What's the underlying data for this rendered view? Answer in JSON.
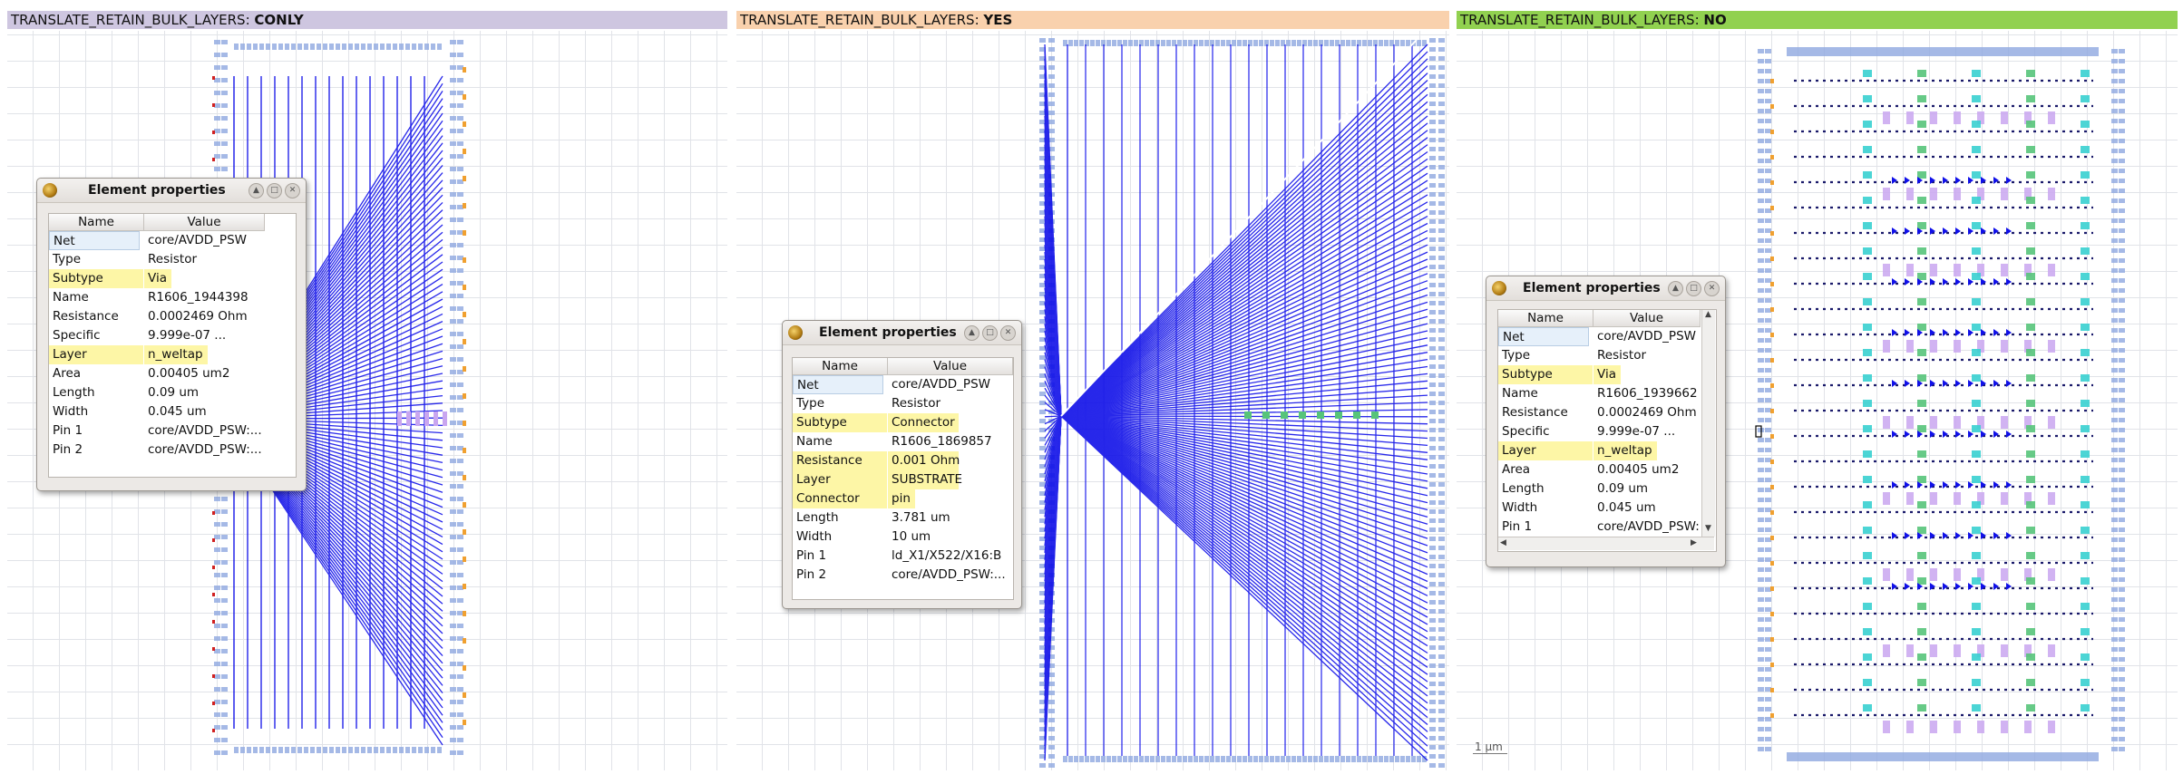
{
  "panels": [
    {
      "header_prefix": "TRANSLATE_RETAIN_BULK_LAYERS: ",
      "header_value": "CONLY",
      "color": "#cec6e0"
    },
    {
      "header_prefix": "TRANSLATE_RETAIN_BULK_LAYERS: ",
      "header_value": "YES",
      "color": "#f9d1ad"
    },
    {
      "header_prefix": "TRANSLATE_RETAIN_BULK_LAYERS: ",
      "header_value": "NO",
      "color": "#91d150"
    }
  ],
  "dialogs": [
    {
      "title": "Element properties",
      "col_name": "Name",
      "col_value": "Value",
      "rows": [
        {
          "name": "Net",
          "value": "core/AVDD_PSW"
        },
        {
          "name": "Type",
          "value": "Resistor"
        },
        {
          "name": "Subtype",
          "value": "Via"
        },
        {
          "name": "Name",
          "value": "R1606_1944398"
        },
        {
          "name": "Resistance",
          "value": "0.0002469 Ohm"
        },
        {
          "name": "Specific",
          "value": "9.999e-07 ..."
        },
        {
          "name": "Layer",
          "value": "n_weltap"
        },
        {
          "name": "Area",
          "value": "0.00405 um2"
        },
        {
          "name": "Length",
          "value": "0.09 um"
        },
        {
          "name": "Width",
          "value": "0.045 um"
        },
        {
          "name": "Pin 1",
          "value": "core/AVDD_PSW:..."
        },
        {
          "name": "Pin 2",
          "value": "core/AVDD_PSW:..."
        }
      ]
    },
    {
      "title": "Element properties",
      "col_name": "Name",
      "col_value": "Value",
      "rows": [
        {
          "name": "Net",
          "value": "core/AVDD_PSW"
        },
        {
          "name": "Type",
          "value": "Resistor"
        },
        {
          "name": "Subtype",
          "value": "Connector"
        },
        {
          "name": "Name",
          "value": "R1606_1869857"
        },
        {
          "name": "Resistance",
          "value": "0.001 Ohm"
        },
        {
          "name": "Layer",
          "value": "SUBSTRATE"
        },
        {
          "name": "Connector",
          "value": "pin"
        },
        {
          "name": "Length",
          "value": "3.781 um"
        },
        {
          "name": "Width",
          "value": "10 um"
        },
        {
          "name": "Pin 1",
          "value": "ld_X1/X522/X16:B"
        },
        {
          "name": "Pin 2",
          "value": "core/AVDD_PSW:..."
        }
      ]
    },
    {
      "title": "Element properties",
      "col_name": "Name",
      "col_value": "Value",
      "rows": [
        {
          "name": "Net",
          "value": "core/AVDD_PSW"
        },
        {
          "name": "Type",
          "value": "Resistor"
        },
        {
          "name": "Subtype",
          "value": "Via"
        },
        {
          "name": "Name",
          "value": "R1606_1939662"
        },
        {
          "name": "Resistance",
          "value": "0.0002469 Ohm"
        },
        {
          "name": "Specific",
          "value": "9.999e-07 ..."
        },
        {
          "name": "Layer",
          "value": "n_weltap"
        },
        {
          "name": "Area",
          "value": "0.00405 um2"
        },
        {
          "name": "Length",
          "value": "0.09 um"
        },
        {
          "name": "Width",
          "value": "0.045 um"
        },
        {
          "name": "Pin 1",
          "value": "core/AVDD_PSW:..."
        }
      ]
    }
  ],
  "scale_label": "1 µm",
  "colors": {
    "wire": "#1010e8",
    "grid": "#c9cdd6",
    "highlight": "#fdf6a6",
    "cell_fill": "#8fa8e0",
    "purple": "#c9a6f0",
    "green": "#56c47a",
    "orange": "#f0a030",
    "red": "#d02020"
  },
  "icons": {
    "logo": "app-logo-icon",
    "buttons": [
      "minimize-icon",
      "maximize-icon",
      "close-icon"
    ]
  }
}
